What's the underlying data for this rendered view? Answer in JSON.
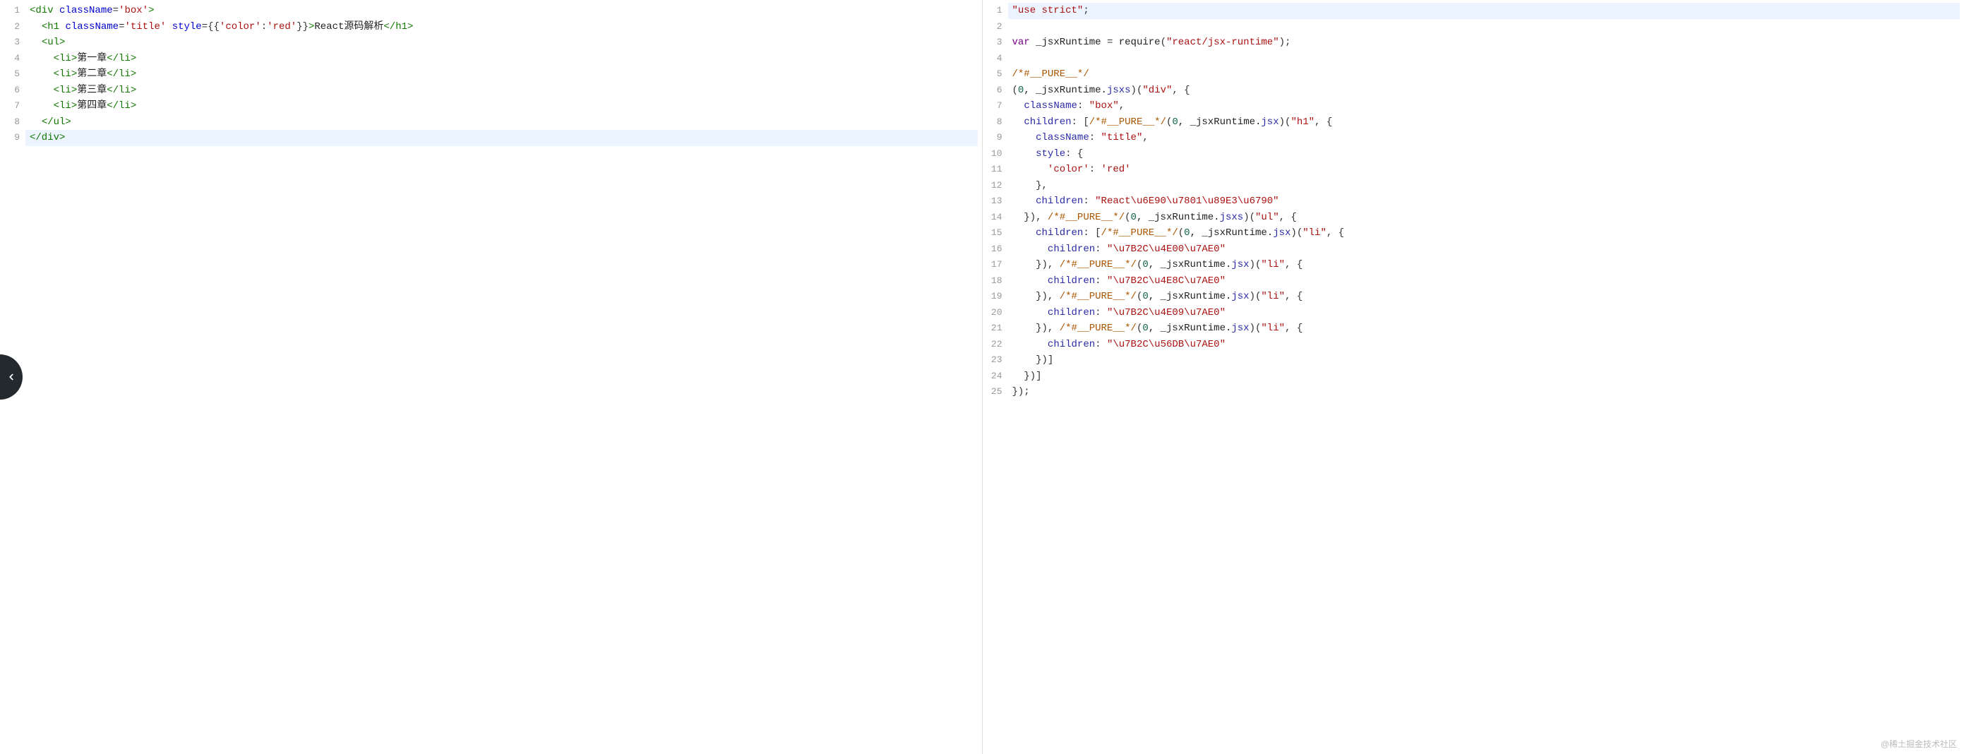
{
  "watermark": "@稀土掘金技术社区",
  "left": {
    "lineCount": 9,
    "highlight": 9,
    "lines": [
      {
        "n": 1,
        "tokens": [
          {
            "t": "<div",
            "c": "tag"
          },
          {
            "t": " ",
            "c": "plain"
          },
          {
            "t": "className",
            "c": "attr-name"
          },
          {
            "t": "=",
            "c": "punct"
          },
          {
            "t": "'box'",
            "c": "attr-val"
          },
          {
            "t": ">",
            "c": "tag"
          }
        ]
      },
      {
        "n": 2,
        "tokens": [
          {
            "t": "  ",
            "c": "plain"
          },
          {
            "t": "<h1",
            "c": "tag"
          },
          {
            "t": " ",
            "c": "plain"
          },
          {
            "t": "className",
            "c": "attr-name"
          },
          {
            "t": "=",
            "c": "punct"
          },
          {
            "t": "'title'",
            "c": "attr-val"
          },
          {
            "t": " ",
            "c": "plain"
          },
          {
            "t": "style",
            "c": "attr-name"
          },
          {
            "t": "=",
            "c": "punct"
          },
          {
            "t": "{{",
            "c": "punct"
          },
          {
            "t": "'color'",
            "c": "attr-val"
          },
          {
            "t": ":",
            "c": "punct"
          },
          {
            "t": "'red'",
            "c": "attr-val"
          },
          {
            "t": "}}",
            "c": "punct"
          },
          {
            "t": ">",
            "c": "tag"
          },
          {
            "t": "React源码解析",
            "c": "plain"
          },
          {
            "t": "</h1>",
            "c": "tag"
          }
        ]
      },
      {
        "n": 3,
        "tokens": [
          {
            "t": "  ",
            "c": "plain"
          },
          {
            "t": "<ul>",
            "c": "tag"
          }
        ]
      },
      {
        "n": 4,
        "tokens": [
          {
            "t": "    ",
            "c": "plain"
          },
          {
            "t": "<li>",
            "c": "tag"
          },
          {
            "t": "第一章",
            "c": "plain"
          },
          {
            "t": "</li>",
            "c": "tag"
          }
        ]
      },
      {
        "n": 5,
        "tokens": [
          {
            "t": "    ",
            "c": "plain"
          },
          {
            "t": "<li>",
            "c": "tag"
          },
          {
            "t": "第二章",
            "c": "plain"
          },
          {
            "t": "</li>",
            "c": "tag"
          }
        ]
      },
      {
        "n": 6,
        "tokens": [
          {
            "t": "    ",
            "c": "plain"
          },
          {
            "t": "<li>",
            "c": "tag"
          },
          {
            "t": "第三章",
            "c": "plain"
          },
          {
            "t": "</li>",
            "c": "tag"
          }
        ]
      },
      {
        "n": 7,
        "tokens": [
          {
            "t": "    ",
            "c": "plain"
          },
          {
            "t": "<li>",
            "c": "tag"
          },
          {
            "t": "第四章",
            "c": "plain"
          },
          {
            "t": "</li>",
            "c": "tag"
          }
        ]
      },
      {
        "n": 8,
        "tokens": [
          {
            "t": "  ",
            "c": "plain"
          },
          {
            "t": "</ul>",
            "c": "tag"
          }
        ]
      },
      {
        "n": 9,
        "tokens": [
          {
            "t": "</div>",
            "c": "tag"
          }
        ]
      }
    ]
  },
  "right": {
    "lineCount": 25,
    "highlight": 1,
    "lines": [
      {
        "n": 1,
        "tokens": [
          {
            "t": "\"use strict\"",
            "c": "str"
          },
          {
            "t": ";",
            "c": "punct"
          }
        ]
      },
      {
        "n": 2,
        "tokens": []
      },
      {
        "n": 3,
        "tokens": [
          {
            "t": "var",
            "c": "kw"
          },
          {
            "t": " _jsxRuntime ",
            "c": "ident"
          },
          {
            "t": "=",
            "c": "punct"
          },
          {
            "t": " ",
            "c": "plain"
          },
          {
            "t": "require",
            "c": "ident"
          },
          {
            "t": "(",
            "c": "punct"
          },
          {
            "t": "\"react/jsx-runtime\"",
            "c": "str"
          },
          {
            "t": ");",
            "c": "punct"
          }
        ]
      },
      {
        "n": 4,
        "tokens": []
      },
      {
        "n": 5,
        "tokens": [
          {
            "t": "/*#__PURE__*/",
            "c": "comment"
          }
        ]
      },
      {
        "n": 6,
        "tokens": [
          {
            "t": "(",
            "c": "punct"
          },
          {
            "t": "0",
            "c": "num"
          },
          {
            "t": ", _jsxRuntime.",
            "c": "ident"
          },
          {
            "t": "jsxs",
            "c": "prop"
          },
          {
            "t": ")(",
            "c": "punct"
          },
          {
            "t": "\"div\"",
            "c": "str"
          },
          {
            "t": ", {",
            "c": "punct"
          }
        ]
      },
      {
        "n": 7,
        "tokens": [
          {
            "t": "  ",
            "c": "plain"
          },
          {
            "t": "className",
            "c": "prop"
          },
          {
            "t": ": ",
            "c": "punct"
          },
          {
            "t": "\"box\"",
            "c": "str"
          },
          {
            "t": ",",
            "c": "punct"
          }
        ]
      },
      {
        "n": 8,
        "tokens": [
          {
            "t": "  ",
            "c": "plain"
          },
          {
            "t": "children",
            "c": "prop"
          },
          {
            "t": ": [",
            "c": "punct"
          },
          {
            "t": "/*#__PURE__*/",
            "c": "comment"
          },
          {
            "t": "(",
            "c": "punct"
          },
          {
            "t": "0",
            "c": "num"
          },
          {
            "t": ", _jsxRuntime.",
            "c": "ident"
          },
          {
            "t": "jsx",
            "c": "prop"
          },
          {
            "t": ")(",
            "c": "punct"
          },
          {
            "t": "\"h1\"",
            "c": "str"
          },
          {
            "t": ", {",
            "c": "punct"
          }
        ]
      },
      {
        "n": 9,
        "tokens": [
          {
            "t": "    ",
            "c": "plain"
          },
          {
            "t": "className",
            "c": "prop"
          },
          {
            "t": ": ",
            "c": "punct"
          },
          {
            "t": "\"title\"",
            "c": "str"
          },
          {
            "t": ",",
            "c": "punct"
          }
        ]
      },
      {
        "n": 10,
        "tokens": [
          {
            "t": "    ",
            "c": "plain"
          },
          {
            "t": "style",
            "c": "prop"
          },
          {
            "t": ": {",
            "c": "punct"
          }
        ]
      },
      {
        "n": 11,
        "tokens": [
          {
            "t": "      ",
            "c": "plain"
          },
          {
            "t": "'color'",
            "c": "str"
          },
          {
            "t": ": ",
            "c": "punct"
          },
          {
            "t": "'red'",
            "c": "str"
          }
        ]
      },
      {
        "n": 12,
        "tokens": [
          {
            "t": "    },",
            "c": "punct"
          }
        ]
      },
      {
        "n": 13,
        "tokens": [
          {
            "t": "    ",
            "c": "plain"
          },
          {
            "t": "children",
            "c": "prop"
          },
          {
            "t": ": ",
            "c": "punct"
          },
          {
            "t": "\"React\\u6E90\\u7801\\u89E3\\u6790\"",
            "c": "str"
          }
        ]
      },
      {
        "n": 14,
        "tokens": [
          {
            "t": "  }), ",
            "c": "punct"
          },
          {
            "t": "/*#__PURE__*/",
            "c": "comment"
          },
          {
            "t": "(",
            "c": "punct"
          },
          {
            "t": "0",
            "c": "num"
          },
          {
            "t": ", _jsxRuntime.",
            "c": "ident"
          },
          {
            "t": "jsxs",
            "c": "prop"
          },
          {
            "t": ")(",
            "c": "punct"
          },
          {
            "t": "\"ul\"",
            "c": "str"
          },
          {
            "t": ", {",
            "c": "punct"
          }
        ]
      },
      {
        "n": 15,
        "tokens": [
          {
            "t": "    ",
            "c": "plain"
          },
          {
            "t": "children",
            "c": "prop"
          },
          {
            "t": ": [",
            "c": "punct"
          },
          {
            "t": "/*#__PURE__*/",
            "c": "comment"
          },
          {
            "t": "(",
            "c": "punct"
          },
          {
            "t": "0",
            "c": "num"
          },
          {
            "t": ", _jsxRuntime.",
            "c": "ident"
          },
          {
            "t": "jsx",
            "c": "prop"
          },
          {
            "t": ")(",
            "c": "punct"
          },
          {
            "t": "\"li\"",
            "c": "str"
          },
          {
            "t": ", {",
            "c": "punct"
          }
        ]
      },
      {
        "n": 16,
        "tokens": [
          {
            "t": "      ",
            "c": "plain"
          },
          {
            "t": "children",
            "c": "prop"
          },
          {
            "t": ": ",
            "c": "punct"
          },
          {
            "t": "\"\\u7B2C\\u4E00\\u7AE0\"",
            "c": "str"
          }
        ]
      },
      {
        "n": 17,
        "tokens": [
          {
            "t": "    }), ",
            "c": "punct"
          },
          {
            "t": "/*#__PURE__*/",
            "c": "comment"
          },
          {
            "t": "(",
            "c": "punct"
          },
          {
            "t": "0",
            "c": "num"
          },
          {
            "t": ", _jsxRuntime.",
            "c": "ident"
          },
          {
            "t": "jsx",
            "c": "prop"
          },
          {
            "t": ")(",
            "c": "punct"
          },
          {
            "t": "\"li\"",
            "c": "str"
          },
          {
            "t": ", {",
            "c": "punct"
          }
        ]
      },
      {
        "n": 18,
        "tokens": [
          {
            "t": "      ",
            "c": "plain"
          },
          {
            "t": "children",
            "c": "prop"
          },
          {
            "t": ": ",
            "c": "punct"
          },
          {
            "t": "\"\\u7B2C\\u4E8C\\u7AE0\"",
            "c": "str"
          }
        ]
      },
      {
        "n": 19,
        "tokens": [
          {
            "t": "    }), ",
            "c": "punct"
          },
          {
            "t": "/*#__PURE__*/",
            "c": "comment"
          },
          {
            "t": "(",
            "c": "punct"
          },
          {
            "t": "0",
            "c": "num"
          },
          {
            "t": ", _jsxRuntime.",
            "c": "ident"
          },
          {
            "t": "jsx",
            "c": "prop"
          },
          {
            "t": ")(",
            "c": "punct"
          },
          {
            "t": "\"li\"",
            "c": "str"
          },
          {
            "t": ", {",
            "c": "punct"
          }
        ]
      },
      {
        "n": 20,
        "tokens": [
          {
            "t": "      ",
            "c": "plain"
          },
          {
            "t": "children",
            "c": "prop"
          },
          {
            "t": ": ",
            "c": "punct"
          },
          {
            "t": "\"\\u7B2C\\u4E09\\u7AE0\"",
            "c": "str"
          }
        ]
      },
      {
        "n": 21,
        "tokens": [
          {
            "t": "    }), ",
            "c": "punct"
          },
          {
            "t": "/*#__PURE__*/",
            "c": "comment"
          },
          {
            "t": "(",
            "c": "punct"
          },
          {
            "t": "0",
            "c": "num"
          },
          {
            "t": ", _jsxRuntime.",
            "c": "ident"
          },
          {
            "t": "jsx",
            "c": "prop"
          },
          {
            "t": ")(",
            "c": "punct"
          },
          {
            "t": "\"li\"",
            "c": "str"
          },
          {
            "t": ", {",
            "c": "punct"
          }
        ]
      },
      {
        "n": 22,
        "tokens": [
          {
            "t": "      ",
            "c": "plain"
          },
          {
            "t": "children",
            "c": "prop"
          },
          {
            "t": ": ",
            "c": "punct"
          },
          {
            "t": "\"\\u7B2C\\u56DB\\u7AE0\"",
            "c": "str"
          }
        ]
      },
      {
        "n": 23,
        "tokens": [
          {
            "t": "    })]",
            "c": "punct"
          }
        ]
      },
      {
        "n": 24,
        "tokens": [
          {
            "t": "  })]",
            "c": "punct"
          }
        ]
      },
      {
        "n": 25,
        "tokens": [
          {
            "t": "});",
            "c": "punct"
          }
        ]
      }
    ]
  }
}
